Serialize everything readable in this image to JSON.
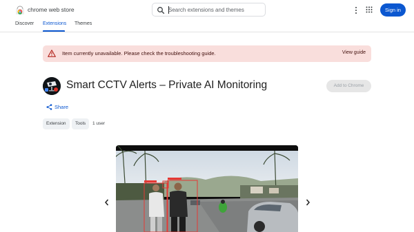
{
  "header": {
    "brand": "chrome web store",
    "search_placeholder": "Search extensions and themes",
    "signin_label": "Sign in"
  },
  "nav": {
    "items": [
      {
        "label": "Discover"
      },
      {
        "label": "Extensions"
      },
      {
        "label": "Themes"
      }
    ],
    "active": "Extensions"
  },
  "alert": {
    "message": "Item currently unavailable. Please check the troubleshooting guide.",
    "action": "View guide"
  },
  "extension": {
    "title": "Smart CCTV Alerts – Private AI Monitoring",
    "add_label": "Add to Chrome",
    "share_label": "Share",
    "chips": [
      "Extension",
      "Tools"
    ],
    "users": "1 user"
  },
  "colors": {
    "accent": "#0b57d0",
    "alert_bg": "#f9dedc",
    "alert_icon": "#b3261e"
  }
}
